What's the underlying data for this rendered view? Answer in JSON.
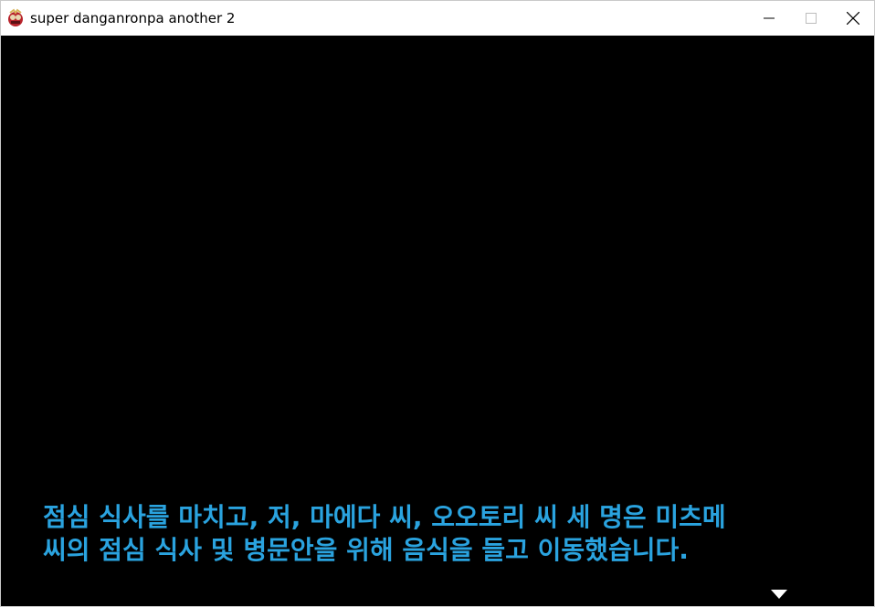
{
  "window": {
    "title": "super danganronpa another 2",
    "app_icon": "game-app-icon",
    "controls": {
      "minimize_icon": "minimize-icon",
      "maximize_icon": "maximize-icon",
      "close_icon": "close-icon"
    }
  },
  "game": {
    "background_color": "#000000",
    "message": {
      "lines": [
        "점심 식사를 마치고, 저, 마에다 씨, 오오토리 씨 세 명은 미츠메",
        "씨의 점심 식사 및 병문안을 위해 음식을 들고 이동했습니다."
      ],
      "text_color": "#2aa3df"
    },
    "continue_indicator_icon": "down-triangle-icon"
  }
}
